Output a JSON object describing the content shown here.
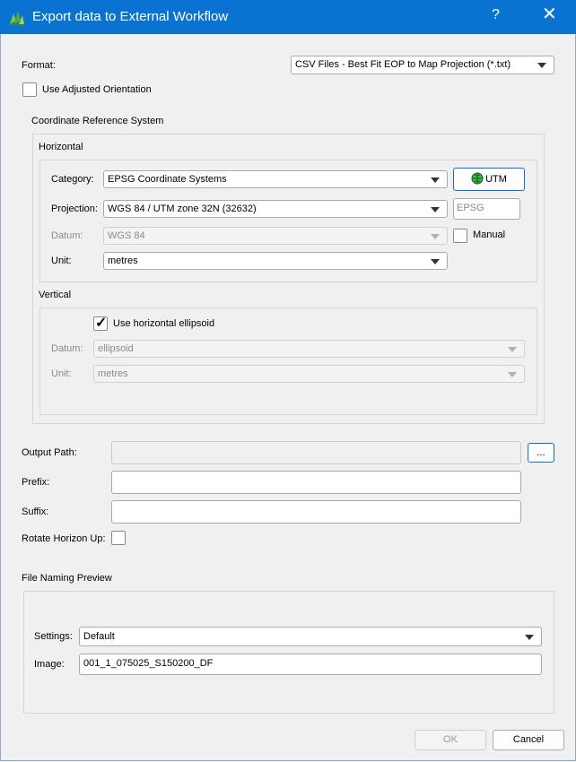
{
  "window": {
    "title": "Export data to External Workflow",
    "help_label": "?",
    "close_label": "✕"
  },
  "format": {
    "label": "Format:",
    "value": "CSV Files - Best Fit EOP to Map Projection (*.txt)"
  },
  "use_adjusted_orientation": {
    "label": "Use Adjusted Orientation",
    "checked": false
  },
  "crs": {
    "title": "Coordinate Reference System",
    "horizontal": {
      "title": "Horizontal",
      "category_label": "Category:",
      "category_value": "EPSG Coordinate Systems",
      "utm_button": "UTM",
      "projection_label": "Projection:",
      "projection_value": "WGS 84 / UTM zone 32N (32632)",
      "epsg_placeholder": "EPSG",
      "datum_label": "Datum:",
      "datum_value": "WGS 84",
      "manual_label": "Manual",
      "unit_label": "Unit:",
      "unit_value": "metres"
    },
    "vertical": {
      "title": "Vertical",
      "use_horizontal_label": "Use horizontal ellipsoid",
      "use_horizontal_checked": true,
      "check_mark": "✓",
      "datum_label": "Datum:",
      "datum_value": "ellipsoid",
      "unit_label": "Unit:",
      "unit_value": "metres"
    }
  },
  "output_path": {
    "label": "Output Path:",
    "value": "",
    "browse_label": "..."
  },
  "prefix": {
    "label": "Prefix:",
    "value": ""
  },
  "suffix": {
    "label": "Suffix:",
    "value": ""
  },
  "rotate_horizon": {
    "label": "Rotate Horizon Up:",
    "checked": false
  },
  "preview": {
    "title": "File Naming Preview",
    "settings_label": "Settings:",
    "settings_value": "Default",
    "image_label": "Image:",
    "image_value": "001_1_075025_S150200_DF"
  },
  "buttons": {
    "ok": "OK",
    "cancel": "Cancel"
  },
  "colors": {
    "titlebar": "#0a73d1",
    "background": "#f0f0f0"
  }
}
